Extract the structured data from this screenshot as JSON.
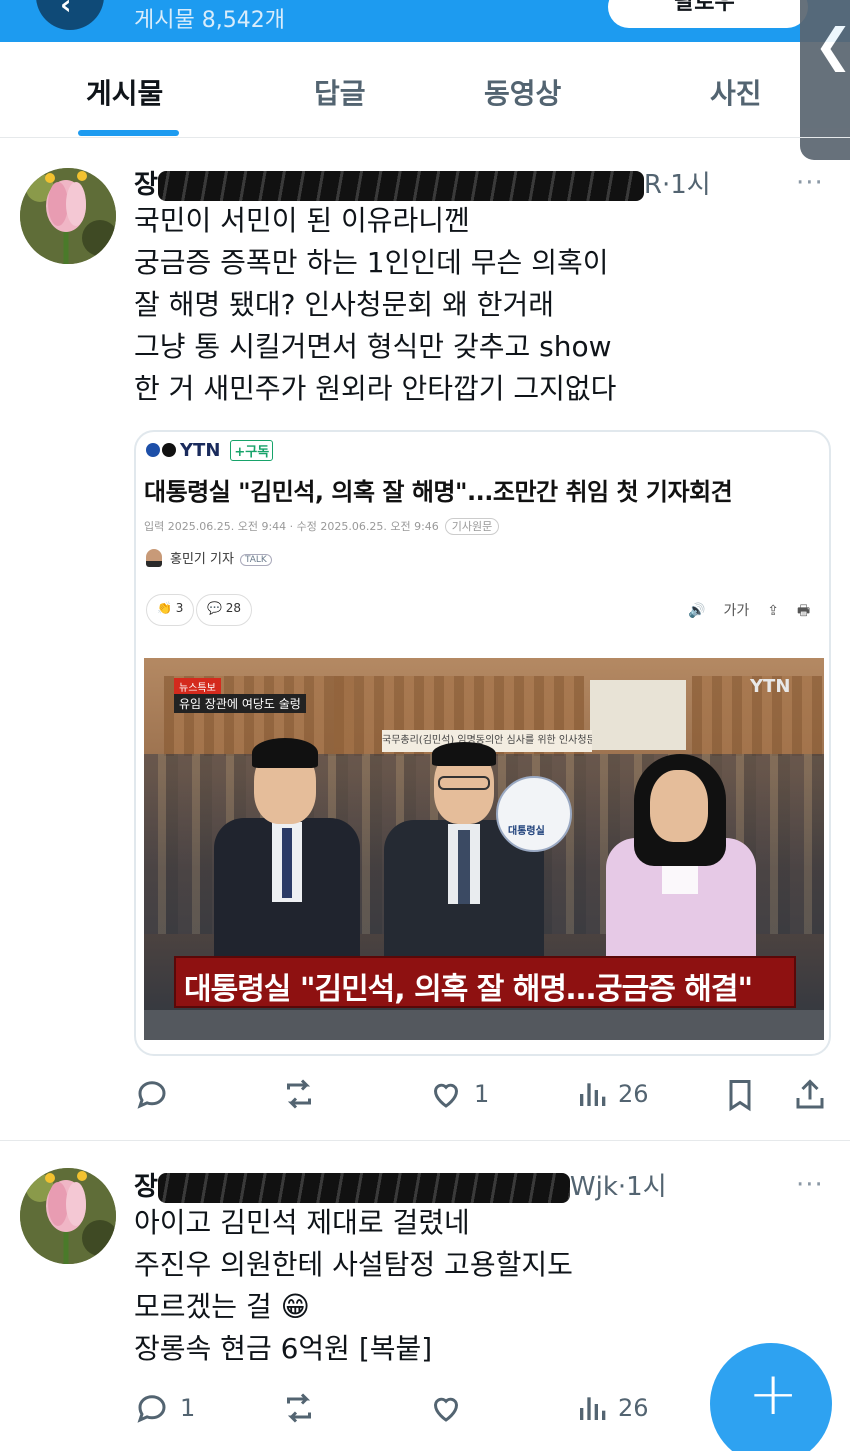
{
  "header": {
    "back_icon": "chevron-left-icon",
    "post_count": "게시물 8,542개",
    "follow_label": "팔로우"
  },
  "side_handle_glyph": "❮",
  "tabs": [
    {
      "label": "게시물",
      "active": true
    },
    {
      "label": "답글",
      "active": false
    },
    {
      "label": "동영상",
      "active": false
    },
    {
      "label": "사진",
      "active": false
    }
  ],
  "posts": [
    {
      "author_prefix": "장",
      "author_suffix": "R",
      "time": "·1시",
      "more": "···",
      "lines": [
        "국민이 서민이 된 이유라니껜",
        "궁금증 증폭만 하는 1인인데 무슨 의혹이",
        "잘 해명 됐대? 인사청문회 왜 한거래",
        "그냥 통 시킬거면서 형식만 갖추고 show",
        "한 거 새민주가 원외라 안타깝기 그지없다"
      ],
      "card": {
        "source": "YTN",
        "subscribe": "구독",
        "title": "대통령실 \"김민석, 의혹 잘 해명\"...조만간 취임 첫 기자회견",
        "date": "입력 2025.06.25. 오전 9:44 · 수정 2025.06.25. 오전 9:46",
        "original_tag": "기사원문",
        "reporter": "홍민기 기자",
        "talk": "TALK",
        "likes": "3",
        "comments": "28",
        "tools": [
          "🔊",
          "가가",
          "⇪",
          "🖶"
        ],
        "image": {
          "watermark": "YTN",
          "breaking_label": "뉴스특보",
          "breaking_sub": "유임 장관에 여당도 술렁",
          "banner": "국무총리(김민석) 임명동의안 심사를 위한 인사청문회",
          "seal_text": "대통령실",
          "caption": "대통령실 \"김민석, 의혹 잘 해명…궁금증 해결\""
        }
      },
      "actions": {
        "reply": "",
        "repost": "",
        "like": "1",
        "views": "26"
      }
    },
    {
      "author_prefix": "장",
      "author_suffix": "Wjk",
      "time": "·1시",
      "more": "···",
      "lines": [
        "아이고 김민석 제대로 걸렸네",
        "주진우 의원한테 사설탐정 고용할지도",
        "모르겠는 걸  😁",
        "장롱속 현금 6억원 [복붙]"
      ],
      "actions": {
        "reply": "1",
        "repost": "",
        "like": "",
        "views": "26"
      }
    }
  ],
  "fab_glyph": "+"
}
